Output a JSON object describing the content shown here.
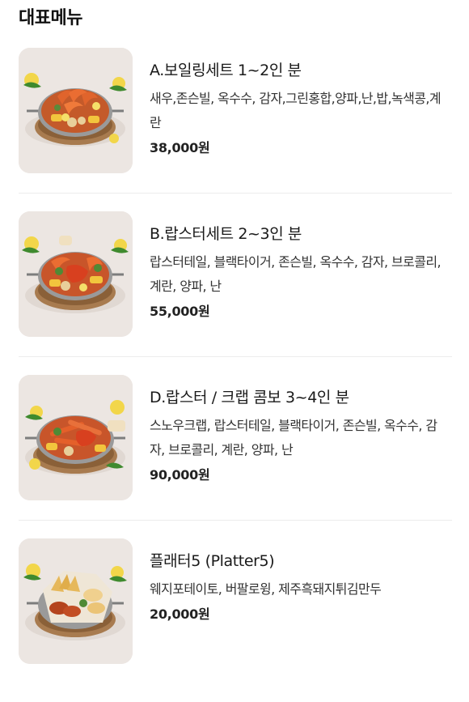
{
  "section": {
    "title": "대표메뉴"
  },
  "menu": [
    {
      "name": "A.보일링세트 1~2인 분",
      "description": "새우,존슨빌, 옥수수, 감자,그린홍합,양파,난,밥,녹색콩,계란",
      "price": "38,000원",
      "image": "boiling-set-photo"
    },
    {
      "name": "B.랍스터세트 2~3인 분",
      "description": "랍스터테일, 블랙타이거, 존슨빌, 옥수수, 감자, 브로콜리, 계란, 양파, 난",
      "price": "55,000원",
      "image": "lobster-set-photo"
    },
    {
      "name": "D.랍스터 / 크랩 콤보 3~4인 분",
      "description": "스노우크랩, 랍스터테일, 블랙타이거, 존슨빌, 옥수수, 감자, 브로콜리, 계란, 양파, 난",
      "price": "90,000원",
      "image": "lobster-crab-combo-photo"
    },
    {
      "name": "플래터5 (Platter5)",
      "description": "웨지포테이토, 버팔로윙, 제주흑돼지튀김만두",
      "price": "20,000원",
      "image": "platter5-photo"
    }
  ],
  "colors": {
    "background": "#ffffff",
    "title": "#111111",
    "text": "#333333",
    "divider": "#ececec",
    "photo_backdrop": "#ece6e2"
  }
}
